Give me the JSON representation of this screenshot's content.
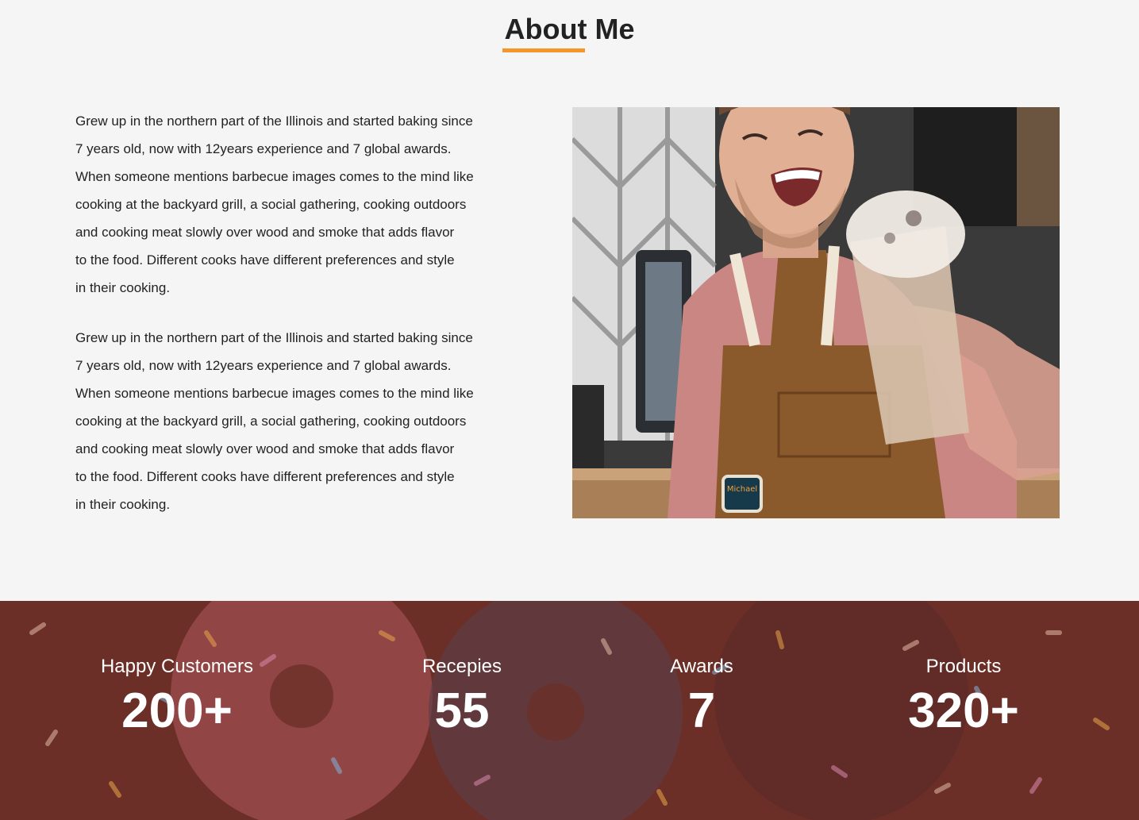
{
  "about": {
    "title": "About Me",
    "paragraphs": [
      {
        "lines": [
          "Grew up in the northern part of the Illinois and started baking since",
          "7 years old, now with 12years experience and 7 global awards.",
          "When someone mentions barbecue images comes to the mind like",
          "cooking at the backyard grill, a social gathering, cooking outdoors",
          "and cooking meat slowly over wood and smoke that adds flavor",
          "to the food. Different cooks have different preferences and style",
          "in their cooking."
        ]
      },
      {
        "lines": [
          "Grew up in the northern part of the Illinois and started baking since",
          "7 years old, now with 12years experience and 7 global awards.",
          "When someone mentions barbecue images comes to the mind like",
          "cooking at the backyard grill, a social gathering, cooking outdoors",
          "and cooking meat slowly over wood and smoke that adds flavor",
          "to the food. Different cooks have different preferences and style",
          "in their cooking."
        ]
      }
    ],
    "photo_badge": "Michael"
  },
  "stats": [
    {
      "label": "Happy Customers",
      "value": "200+"
    },
    {
      "label": "Recepies",
      "value": "55"
    },
    {
      "label": "Awards",
      "value": "7"
    },
    {
      "label": "Products",
      "value": "320+"
    }
  ],
  "colors": {
    "accent": "#f4962a",
    "stats_bg": "#6b2f28",
    "page_bg": "#f5f5f5"
  }
}
